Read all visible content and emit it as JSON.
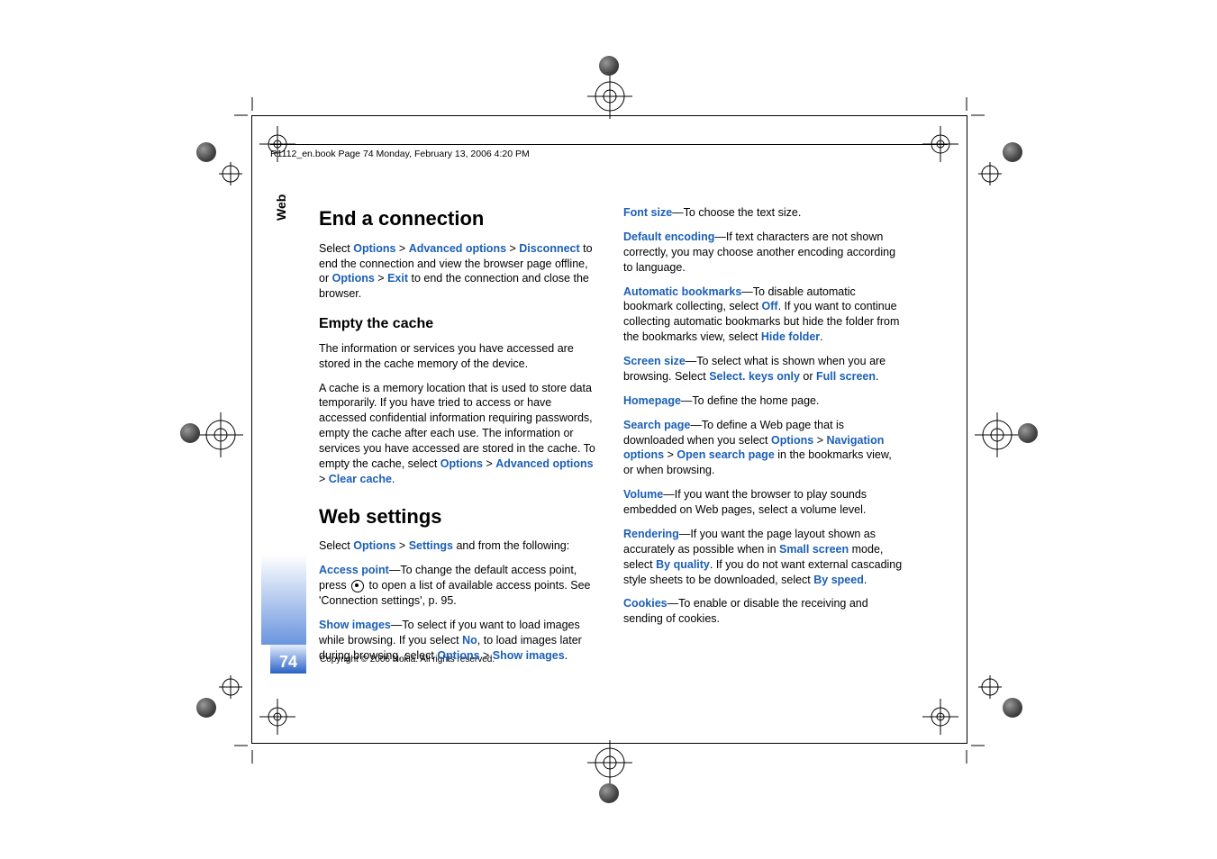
{
  "header": "R1112_en.book  Page 74  Monday, February 13, 2006  4:20 PM",
  "side_tab": "Web",
  "page_number": "74",
  "copyright": "Copyright © 2006 Nokia. All rights reserved.",
  "left": {
    "h1": "End a connection",
    "p1a": "Select ",
    "p1b": "Options",
    "p1c": "Advanced options",
    "p1d": "Disconnect",
    "p1e": " to end the connection and view the browser page offline, or ",
    "p1f": "Options",
    "p1g": "Exit",
    "p1h": " to end the connection and close the browser.",
    "h3a": "Empty the cache",
    "p2": "The information or services you have accessed are stored in the cache memory of the device.",
    "p3a": "A cache is a memory location that is used to store data temporarily. If you have tried to access or have accessed confidential information requiring passwords, empty the cache after each use. The information or services you have accessed are stored in the cache. To empty the cache, select ",
    "p3b": "Options",
    "p3c": "Advanced options",
    "p3d": "Clear cache",
    "h2": "Web settings",
    "p4a": "Select ",
    "p4b": "Options",
    "p4c": "Settings",
    "p4d": " and from the following:",
    "p5a": "Access point",
    "p5b": "—To change the default access point, press ",
    "p5c": " to open a list of available access points. See 'Connection settings', p. 95.",
    "p6a": "Show images",
    "p6b": "—To select if you want to load images while browsing. If you select ",
    "p6c": "No",
    "p6d": ", to load images later during browsing, select ",
    "p6e": "Options",
    "p6f": "Show images"
  },
  "right": {
    "p1a": "Font size",
    "p1b": "—To choose the text size.",
    "p2a": "Default encoding",
    "p2b": "—If text characters are not shown correctly, you may choose another encoding according to language.",
    "p3a": "Automatic bookmarks",
    "p3b": "—To disable automatic bookmark collecting, select ",
    "p3c": "Off",
    "p3d": ". If you want to continue collecting automatic bookmarks but hide the folder from the bookmarks view, select ",
    "p3e": "Hide folder",
    "p4a": "Screen size",
    "p4b": "—To select what is shown when you are browsing. Select ",
    "p4c": "Select. keys only",
    "p4d": " or ",
    "p4e": "Full screen",
    "p5a": "Homepage",
    "p5b": "—To define the home page.",
    "p6a": "Search page",
    "p6b": "—To define a Web page that is downloaded when you select ",
    "p6c": "Options",
    "p6d": "Navigation options",
    "p6e": "Open search page",
    "p6f": " in the bookmarks view, or when browsing.",
    "p7a": "Volume",
    "p7b": "—If you want the browser to play sounds embedded on Web pages, select a volume level.",
    "p8a": "Rendering",
    "p8b": "—If you want the page layout shown as accurately as possible when in ",
    "p8c": "Small screen",
    "p8d": " mode, select ",
    "p8e": "By quality",
    "p8f": ". If you do not want external cascading style sheets to be downloaded, select ",
    "p8g": "By speed",
    "p9a": "Cookies",
    "p9b": "—To enable or disable the receiving and sending of cookies."
  }
}
